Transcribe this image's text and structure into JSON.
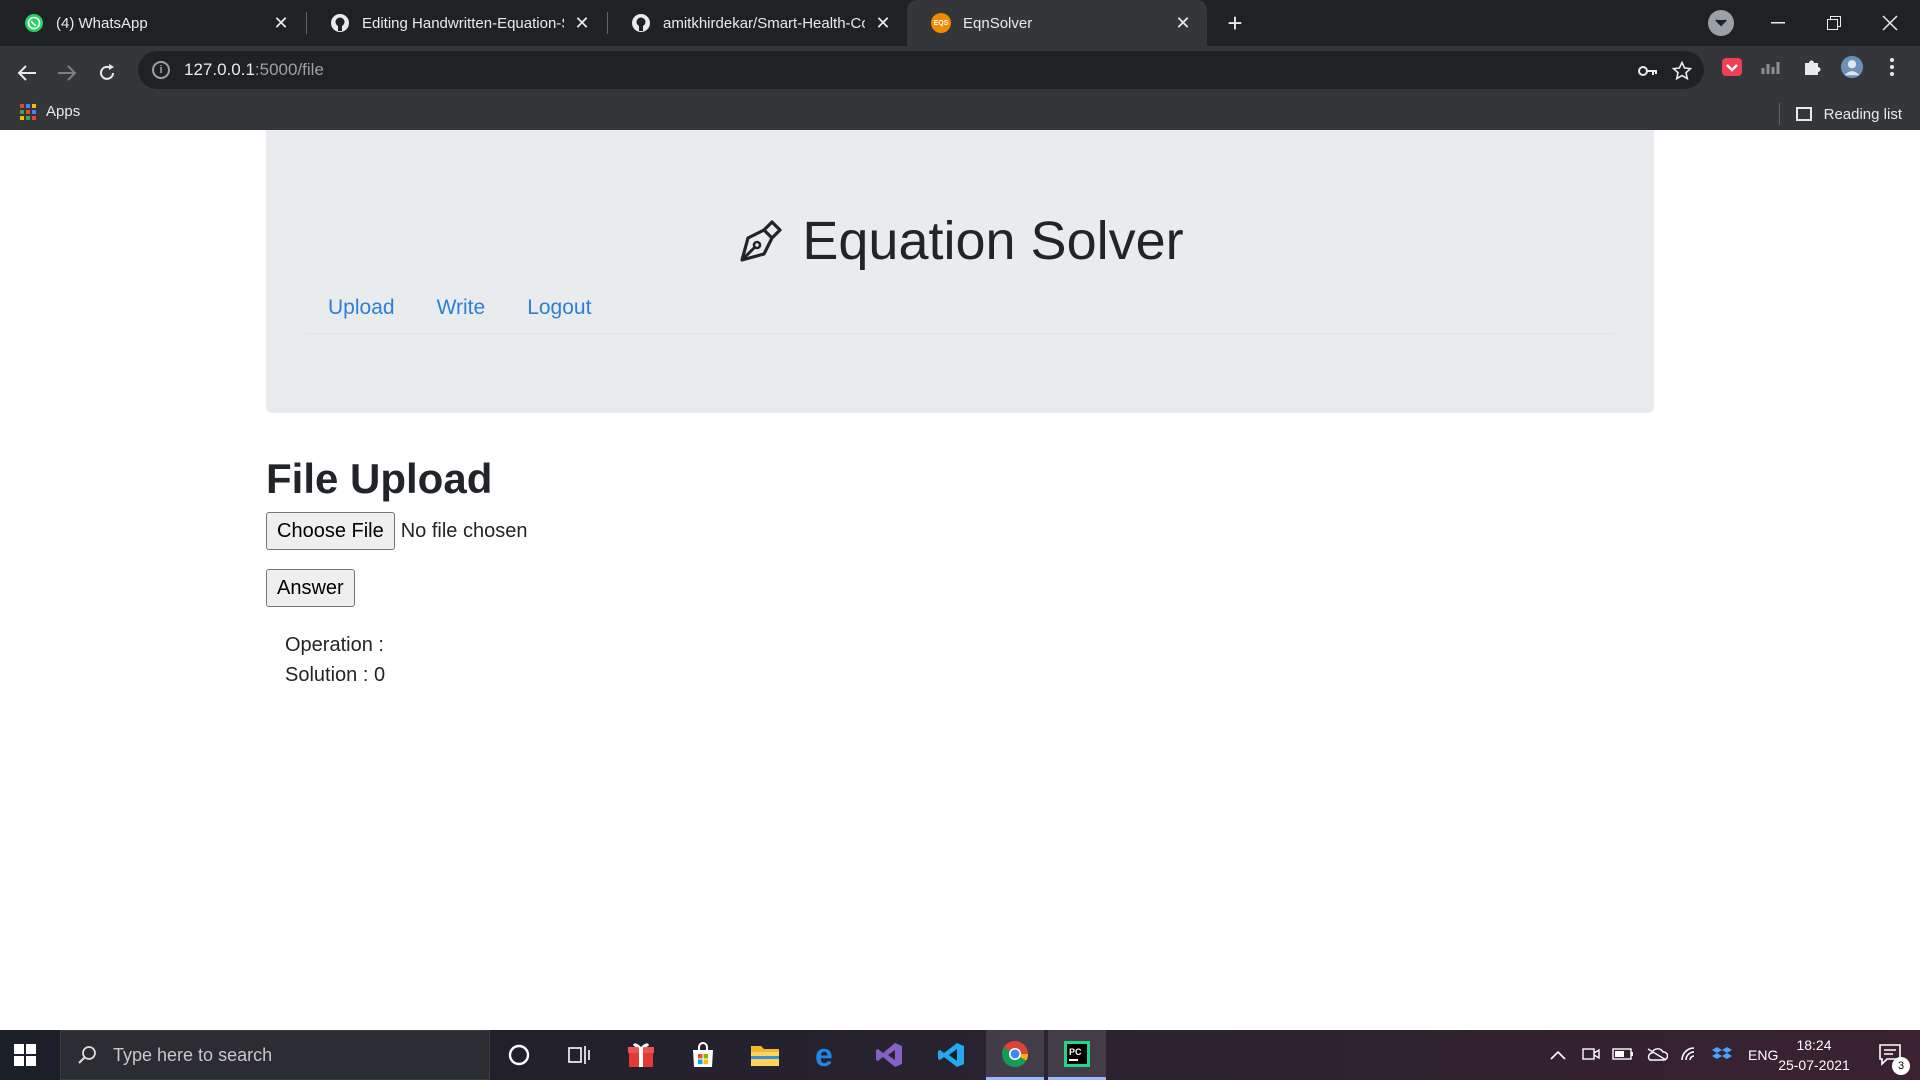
{
  "browser": {
    "tabs": [
      {
        "title": "(4) WhatsApp",
        "icon": "whatsapp-icon",
        "active": false
      },
      {
        "title": "Editing Handwritten-Equation-Sc",
        "icon": "github-icon",
        "active": false
      },
      {
        "title": "amitkhirdekar/Smart-Health-Con",
        "icon": "github-icon",
        "active": false
      },
      {
        "title": "EqnSolver",
        "icon": "eqs-favicon",
        "active": true
      }
    ],
    "favicon_text": "EQS",
    "url_host": "127.0.0.1",
    "url_path": ":5000/file",
    "bookmarks": {
      "apps_label": "Apps",
      "reading_list_label": "Reading list"
    }
  },
  "site": {
    "title": "Equation Solver",
    "nav": [
      "Upload",
      "Write",
      "Logout"
    ]
  },
  "upload": {
    "heading": "File Upload",
    "choose_file_label": "Choose File",
    "no_file_text": "No file chosen",
    "answer_label": "Answer",
    "operation_text": "Operation :",
    "solution_text": "Solution : 0"
  },
  "taskbar": {
    "search_placeholder": "Type here to search",
    "language": "ENG",
    "time": "18:24",
    "date": "25-07-2021",
    "notification_count": "3"
  },
  "colors": {
    "chrome_dark": "#202124",
    "toolbar": "#35363a",
    "hero_bg": "#e9ecef",
    "link": "#2f7fd3"
  }
}
